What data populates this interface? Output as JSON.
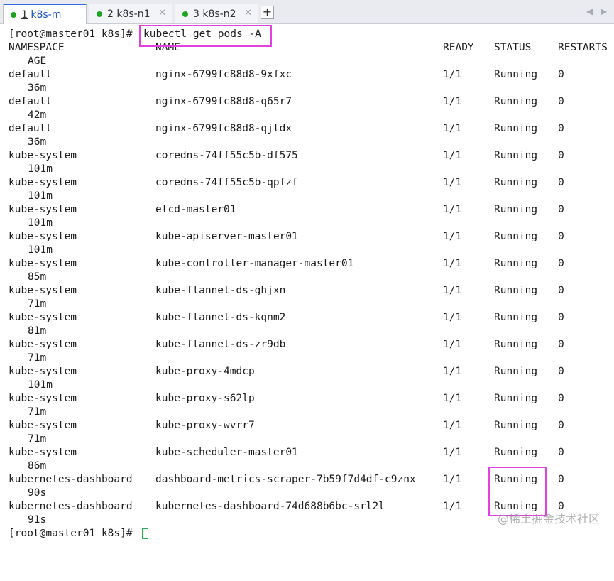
{
  "tabs": [
    {
      "num": "1",
      "label": " k8s-m",
      "active": true
    },
    {
      "num": "2",
      "label": " k8s-n1",
      "active": false
    },
    {
      "num": "3",
      "label": " k8s-n2",
      "active": false
    }
  ],
  "tab_close_glyph": "✕",
  "tab_add_glyph": "+",
  "nav_prev_glyph": "◀",
  "nav_next_glyph": "▶",
  "terminal": {
    "prompt": "[root@master01 k8s]#",
    "command": "kubectl get pods -A",
    "header": {
      "namespace": "NAMESPACE",
      "name": "NAME",
      "ready": "READY",
      "status": "STATUS",
      "restarts": "RESTARTS",
      "age": "AGE"
    },
    "rows": [
      {
        "namespace": "default",
        "name": "nginx-6799fc88d8-9xfxc",
        "ready": "1/1",
        "status": "Running",
        "restarts": "0",
        "age": "36m"
      },
      {
        "namespace": "default",
        "name": "nginx-6799fc88d8-q65r7",
        "ready": "1/1",
        "status": "Running",
        "restarts": "0",
        "age": "42m"
      },
      {
        "namespace": "default",
        "name": "nginx-6799fc88d8-qjtdx",
        "ready": "1/1",
        "status": "Running",
        "restarts": "0",
        "age": "36m"
      },
      {
        "namespace": "kube-system",
        "name": "coredns-74ff55c5b-df575",
        "ready": "1/1",
        "status": "Running",
        "restarts": "0",
        "age": "101m"
      },
      {
        "namespace": "kube-system",
        "name": "coredns-74ff55c5b-qpfzf",
        "ready": "1/1",
        "status": "Running",
        "restarts": "0",
        "age": "101m"
      },
      {
        "namespace": "kube-system",
        "name": "etcd-master01",
        "ready": "1/1",
        "status": "Running",
        "restarts": "0",
        "age": "101m"
      },
      {
        "namespace": "kube-system",
        "name": "kube-apiserver-master01",
        "ready": "1/1",
        "status": "Running",
        "restarts": "0",
        "age": "101m"
      },
      {
        "namespace": "kube-system",
        "name": "kube-controller-manager-master01",
        "ready": "1/1",
        "status": "Running",
        "restarts": "0",
        "age": "85m"
      },
      {
        "namespace": "kube-system",
        "name": "kube-flannel-ds-ghjxn",
        "ready": "1/1",
        "status": "Running",
        "restarts": "0",
        "age": "71m"
      },
      {
        "namespace": "kube-system",
        "name": "kube-flannel-ds-kqnm2",
        "ready": "1/1",
        "status": "Running",
        "restarts": "0",
        "age": "81m"
      },
      {
        "namespace": "kube-system",
        "name": "kube-flannel-ds-zr9db",
        "ready": "1/1",
        "status": "Running",
        "restarts": "0",
        "age": "71m"
      },
      {
        "namespace": "kube-system",
        "name": "kube-proxy-4mdcp",
        "ready": "1/1",
        "status": "Running",
        "restarts": "0",
        "age": "101m"
      },
      {
        "namespace": "kube-system",
        "name": "kube-proxy-s62lp",
        "ready": "1/1",
        "status": "Running",
        "restarts": "0",
        "age": "71m"
      },
      {
        "namespace": "kube-system",
        "name": "kube-proxy-wvrr7",
        "ready": "1/1",
        "status": "Running",
        "restarts": "0",
        "age": "71m"
      },
      {
        "namespace": "kube-system",
        "name": "kube-scheduler-master01",
        "ready": "1/1",
        "status": "Running",
        "restarts": "0",
        "age": "86m"
      },
      {
        "namespace": "kubernetes-dashboard",
        "name": "dashboard-metrics-scraper-7b59f7d4df-c9znx",
        "ready": "1/1",
        "status": "Running",
        "restarts": "0",
        "age": "90s"
      },
      {
        "namespace": "kubernetes-dashboard",
        "name": "kubernetes-dashboard-74d688b6bc-srl2l",
        "ready": "1/1",
        "status": "Running",
        "restarts": "0",
        "age": "91s"
      }
    ]
  },
  "watermark": "@稀土掘金技术社区",
  "colors": {
    "highlight": "#e041e0",
    "cursor": "#22b54a",
    "tab_dot": "#19a51d",
    "active_tab_accent": "#2f6de0"
  }
}
